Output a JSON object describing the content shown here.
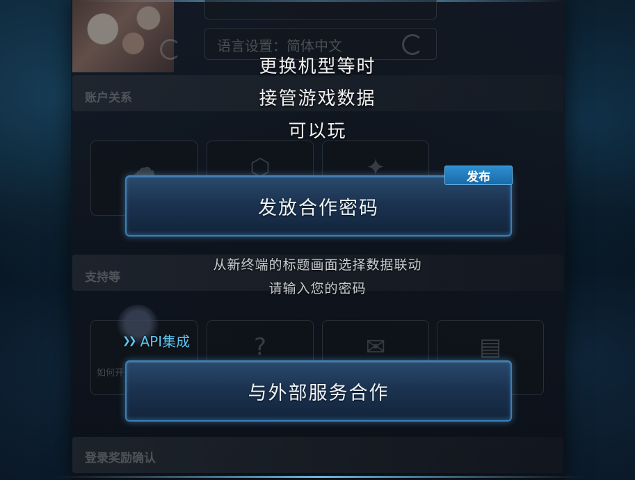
{
  "background_panel": {
    "language_setting": "语言设置：简体中文",
    "section_account": "账户关系",
    "section_support": "支持等",
    "section_login_rewards": "登录奖励确认",
    "support_tile_caption": "如何开"
  },
  "overlay": {
    "title_lines": [
      "更换机型等时",
      "接管游戏数据",
      "可以玩"
    ],
    "publish_badge": "发布",
    "issue_password_button": "发放合作密码",
    "description_lines": [
      "从新终端的标题画面选择数据联动",
      "请输入您的密码"
    ],
    "api_label": "API集成",
    "external_service_button": "与外部服务合作"
  },
  "colors": {
    "accent": "#5fc6f0",
    "button_border": "#3d7fb5",
    "badge": "#1a6aa8"
  },
  "icons": {
    "api": "double-chevron-right-icon",
    "refresh": "refresh-icon",
    "help": "question-icon",
    "mail": "envelope-icon",
    "document": "document-icon"
  }
}
